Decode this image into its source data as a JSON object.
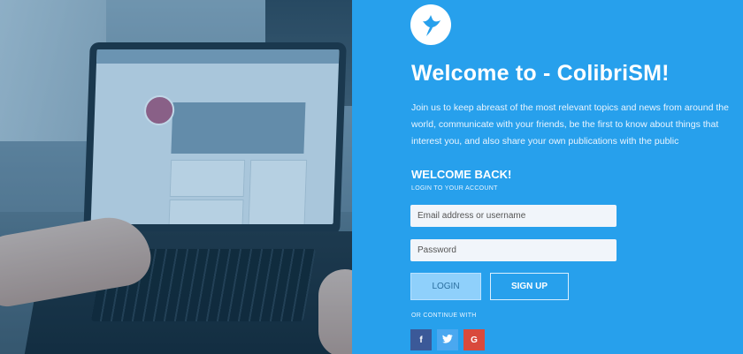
{
  "brand": {
    "logo_icon": "colibri-bird-icon",
    "accent_color": "#27a0ec"
  },
  "header": {
    "title": "Welcome to - ColibriSM!",
    "intro": "Join us to keep abreast of the most relevant topics and news from around the world, communicate with your friends, be the first to know about things that interest you, and also share your own publications with the public"
  },
  "login": {
    "heading": "WELCOME BACK!",
    "subheading": "LOGIN TO YOUR ACCOUNT",
    "email_placeholder": "Email address or username",
    "password_placeholder": "Password",
    "login_label": "LOGIN",
    "signup_label": "SIGN UP",
    "continue_label": "OR CONTINUE WITH"
  },
  "social": {
    "facebook_icon": "facebook-icon",
    "twitter_icon": "twitter-icon",
    "google_icon": "google-icon",
    "facebook_glyph": "f",
    "google_glyph": "G"
  }
}
